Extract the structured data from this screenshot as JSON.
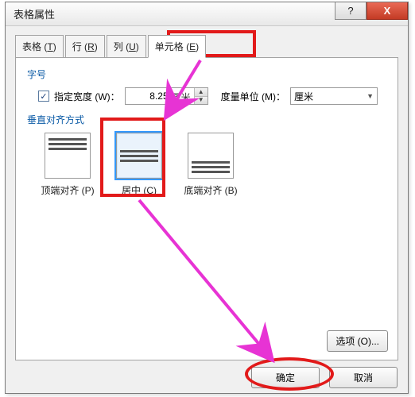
{
  "window": {
    "title": "表格属性",
    "help_label": "?",
    "close_label": "X"
  },
  "tabs": {
    "table": {
      "label": "表格",
      "hotkey": "T"
    },
    "row": {
      "label": "行",
      "hotkey": "R"
    },
    "column": {
      "label": "列",
      "hotkey": "U"
    },
    "cell": {
      "label": "单元格",
      "hotkey": "E"
    }
  },
  "sections": {
    "size_label": "字号",
    "specify_width_label": "指定宽度 (W)：",
    "specify_width_checked": true,
    "width_value": "8.25",
    "width_unit": "厘米",
    "measure_label": "度量单位 (M)：",
    "measure_value": "厘米",
    "valign_label": "垂直对齐方式",
    "top_label": "顶端对齐 (P)",
    "center_label": "居中 (C)",
    "bottom_label": "底端对齐 (B)"
  },
  "buttons": {
    "options": "选项 (O)...",
    "ok": "确定",
    "cancel": "取消"
  }
}
